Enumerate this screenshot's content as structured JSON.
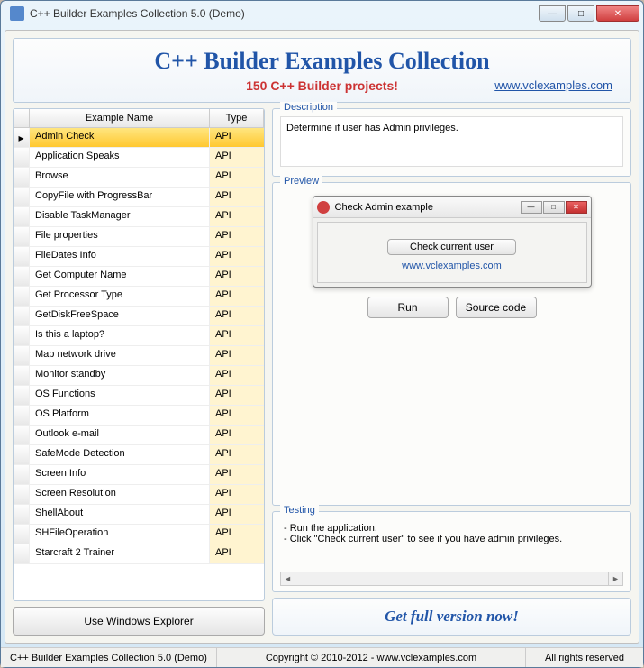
{
  "window": {
    "title": "C++ Builder Examples Collection 5.0 (Demo)"
  },
  "header": {
    "title": "C++ Builder Examples Collection",
    "subtitle": "150 C++ Builder projects!",
    "link": "www.vclexamples.com"
  },
  "grid": {
    "columns": {
      "name": "Example Name",
      "type": "Type"
    },
    "rows": [
      {
        "name": "Admin Check",
        "type": "API",
        "selected": true
      },
      {
        "name": "Application Speaks",
        "type": "API"
      },
      {
        "name": "Browse",
        "type": "API"
      },
      {
        "name": "CopyFile with ProgressBar",
        "type": "API"
      },
      {
        "name": "Disable TaskManager",
        "type": "API"
      },
      {
        "name": "File properties",
        "type": "API"
      },
      {
        "name": "FileDates Info",
        "type": "API"
      },
      {
        "name": "Get Computer Name",
        "type": "API"
      },
      {
        "name": "Get Processor Type",
        "type": "API"
      },
      {
        "name": "GetDiskFreeSpace",
        "type": "API"
      },
      {
        "name": "Is this a laptop?",
        "type": "API"
      },
      {
        "name": "Map network drive",
        "type": "API"
      },
      {
        "name": "Monitor standby",
        "type": "API"
      },
      {
        "name": "OS Functions",
        "type": "API"
      },
      {
        "name": "OS Platform",
        "type": "API"
      },
      {
        "name": "Outlook e-mail",
        "type": "API"
      },
      {
        "name": "SafeMode Detection",
        "type": "API"
      },
      {
        "name": "Screen Info",
        "type": "API"
      },
      {
        "name": "Screen Resolution",
        "type": "API"
      },
      {
        "name": "ShellAbout",
        "type": "API"
      },
      {
        "name": "SHFileOperation",
        "type": "API"
      },
      {
        "name": "Starcraft 2 Trainer",
        "type": "API"
      }
    ]
  },
  "buttons": {
    "explorer": "Use Windows Explorer",
    "run": "Run",
    "source": "Source code",
    "getfull": "Get full version now!"
  },
  "description": {
    "legend": "Description",
    "text": "Determine if user has Admin privileges."
  },
  "preview": {
    "legend": "Preview",
    "window_title": "Check Admin example",
    "button": "Check current user",
    "link": "www.vclexamples.com"
  },
  "testing": {
    "legend": "Testing",
    "line1": "- Run the application.",
    "line2": "- Click \"Check current user\" to see if you have admin privileges."
  },
  "statusbar": {
    "left": "C++ Builder Examples Collection 5.0 (Demo)",
    "center": "Copyright © 2010-2012 - www.vclexamples.com",
    "right": "All rights reserved"
  }
}
